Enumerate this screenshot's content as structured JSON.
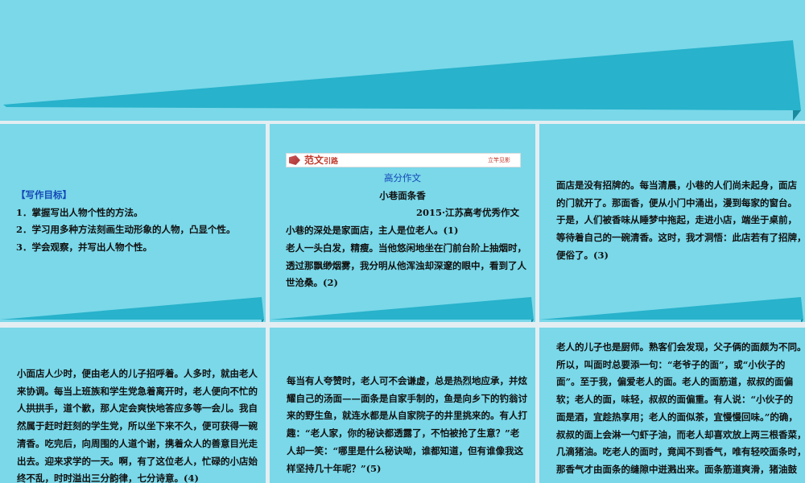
{
  "colors": {
    "slide_bg": "#7ad8e9",
    "ribbon": "#28b2cb",
    "ribbon_dark": "#1a8aa0",
    "gap": "#e3eef2",
    "title_blue": "#1447b8"
  },
  "slides": [
    {
      "id": "slide-title",
      "lines": []
    },
    {
      "id": "slide-goals",
      "heading": "【写作目标】",
      "lines": [
        "1．掌握写出人物个性的方法。",
        "2．学习用多种方法刻画生动形象的人物，凸显个性。",
        "3．学会观察，并写出人物个性。"
      ]
    },
    {
      "id": "slide-essay-1",
      "banner_title": "范文",
      "banner_title_small": "引路",
      "banner_right": "立竿见影",
      "section": "高分作文",
      "title": "小巷面条香",
      "source": "2015·江苏高考优秀作文",
      "lines": [
        "小巷的深处是家面店，主人是位老人。(1)",
        "老人一头白发，精瘦。当他悠闲地坐在门前台阶上抽烟时，",
        "透过那飘缈烟雾，我分明从他浑浊却深邃的眼中，看到了人",
        "世沧桑。(2)"
      ]
    },
    {
      "id": "slide-essay-2",
      "lines": [
        "面店是没有招牌的。每当清晨，小巷的人们尚未起身，面店",
        "的门就开了。那面香，便从小门中涌出，漫到每家的窗台。",
        "于是，人们被香味从睡梦中拖起，走进小店，端坐于桌前，",
        "等待着自己的一碗清香。这时，我才洞悟：此店若有了招牌，",
        "便俗了。(3)"
      ]
    },
    {
      "id": "slide-essay-3",
      "lines": [
        "小面店人少时，便由老人的儿子招呼着。人多时，就由老人",
        "来协调。每当上班族和学生党急着离开时，老人便向不忙的",
        "人拱拱手，道个歉，那人定会爽快地答应多等一会儿。我自",
        "然属于赶时赶刻的学生党，所以坐下来不久，便可获得一碗",
        "清香。吃完后，向周围的人道个谢，携着众人的善意目光走",
        "出去。迎来求学的一天。啊，有了这位老人，忙碌的小店始",
        "终不乱，时时溢出三分韵律，七分诗意。(4)"
      ]
    },
    {
      "id": "slide-essay-4",
      "lines": [
        "每当有人夸赞时，老人可不会谦虚，总是热烈地应承，并炫",
        "耀自己的汤面——面条是自家手制的，鱼是向乡下的钓翁讨",
        "来的野生鱼，就连水都是从自家院子的井里挑来的。有人打",
        "趣：“老人家，你的秘诀都透露了，不怕被抢了生意？”老",
        "人却一笑：“哪里是什么秘诀呦，谁都知道，但有谁像我这",
        "样坚持几十年呢？”(5)"
      ]
    },
    {
      "id": "slide-essay-5",
      "lines": [
        "老人的儿子也是厨师。熟客们会发现，父子俩的面颇为不同。",
        "所以，叫面时总要添一句：“老爷子的面”，或“小伙子的",
        "面”。至于我，偏爱老人的面。老人的面筋道，叔叔的面偏",
        "软；老人的面，味轻，叔叔的面偏重。有人说：“小伙子的",
        "面是酒，宜趁热享用；老人的面似茶，宜慢慢回味。”的确，",
        "叔叔的面上会淋一勺虾子油，而老人却喜欢放上两三根香菜，",
        "几滴猪油。吃老人的面时，竟闻不到香气，唯有轻咬面条时，",
        "那香气才由面条的缝隙中迸溅出来。面条筋道爽滑，猪油鼓"
      ]
    }
  ]
}
